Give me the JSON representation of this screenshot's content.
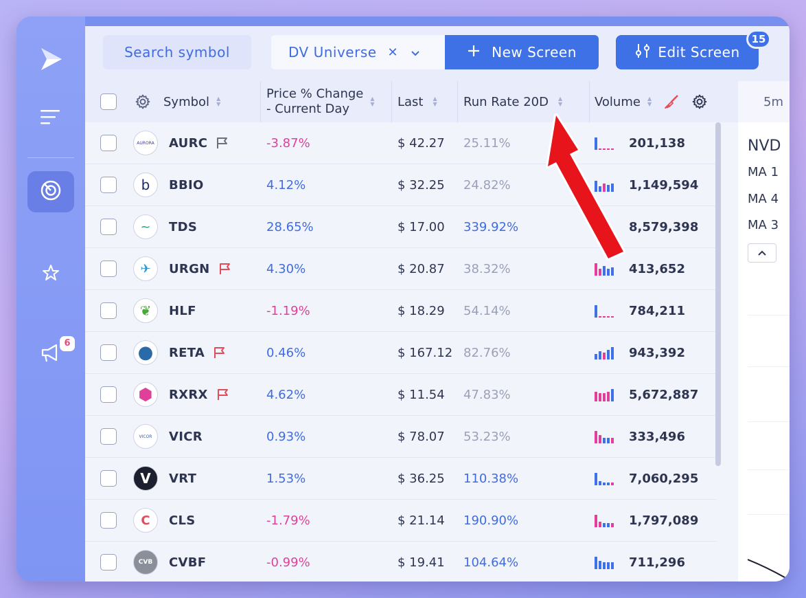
{
  "sidebar": {
    "items": [
      {
        "name": "logo",
        "icon": "play-logo-icon"
      },
      {
        "name": "menu",
        "icon": "menu-lines-icon"
      },
      {
        "name": "scanner",
        "icon": "radar-icon",
        "active": true
      },
      {
        "name": "watchlist",
        "icon": "star-icon"
      },
      {
        "name": "announcements",
        "icon": "megaphone-icon",
        "badge": "6"
      }
    ]
  },
  "toolbar": {
    "search_label": "Search symbol",
    "universe_label": "DV Universe",
    "new_screen_label": "New Screen",
    "edit_screen_label": "Edit Screen",
    "edit_badge": "15"
  },
  "columns": {
    "symbol": "Symbol",
    "price_change_l1": "Price % Change",
    "price_change_l2": "- Current Day",
    "last": "Last",
    "run_rate": "Run Rate 20D",
    "volume": "Volume"
  },
  "right_panel": {
    "timeframe": "5m",
    "ticker": "NVD",
    "ma_lines": [
      "MA 1",
      "MA 4",
      "MA 3"
    ]
  },
  "rows": [
    {
      "symbol": "AURC",
      "flag": "grey",
      "change": "-3.87%",
      "dir": "neg",
      "last": "$ 42.27",
      "run_rate": "25.11%",
      "rr": "muted",
      "volume": "201,138",
      "logo": "AURORA"
    },
    {
      "symbol": "BBIO",
      "flag": "",
      "change": "4.12%",
      "dir": "pos",
      "last": "$ 32.25",
      "run_rate": "24.82%",
      "rr": "muted",
      "volume": "1,149,594",
      "logo": "b"
    },
    {
      "symbol": "TDS",
      "flag": "",
      "change": "28.65%",
      "dir": "pos",
      "last": "$ 17.00",
      "run_rate": "339.92%",
      "rr": "pos",
      "volume": "8,579,398",
      "logo": "~"
    },
    {
      "symbol": "URGN",
      "flag": "red",
      "change": "4.30%",
      "dir": "pos",
      "last": "$ 20.87",
      "run_rate": "38.32%",
      "rr": "muted",
      "volume": "413,652",
      "logo": "✈"
    },
    {
      "symbol": "HLF",
      "flag": "",
      "change": "-1.19%",
      "dir": "neg",
      "last": "$ 18.29",
      "run_rate": "54.14%",
      "rr": "muted",
      "volume": "784,211",
      "logo": "❦"
    },
    {
      "symbol": "RETA",
      "flag": "red",
      "change": "0.46%",
      "dir": "pos",
      "last": "$ 167.12",
      "run_rate": "82.76%",
      "rr": "muted",
      "volume": "943,392",
      "logo": "●"
    },
    {
      "symbol": "RXRX",
      "flag": "red",
      "change": "4.62%",
      "dir": "pos",
      "last": "$ 11.54",
      "run_rate": "47.83%",
      "rr": "muted",
      "volume": "5,672,887",
      "logo": "⬢"
    },
    {
      "symbol": "VICR",
      "flag": "",
      "change": "0.93%",
      "dir": "pos",
      "last": "$ 78.07",
      "run_rate": "53.23%",
      "rr": "muted",
      "volume": "333,496",
      "logo": "VICOR"
    },
    {
      "symbol": "VRT",
      "flag": "",
      "change": "1.53%",
      "dir": "pos",
      "last": "$ 36.25",
      "run_rate": "110.38%",
      "rr": "pos",
      "volume": "7,060,295",
      "logo": "V"
    },
    {
      "symbol": "CLS",
      "flag": "",
      "change": "-1.79%",
      "dir": "neg",
      "last": "$ 21.14",
      "run_rate": "190.90%",
      "rr": "pos",
      "volume": "1,797,089",
      "logo": "C"
    },
    {
      "symbol": "CVBF",
      "flag": "",
      "change": "-0.99%",
      "dir": "neg",
      "last": "$ 19.41",
      "run_rate": "104.64%",
      "rr": "pos",
      "volume": "711,296",
      "logo": "CVB"
    }
  ],
  "colors": {
    "accent": "#3e70e6",
    "negative": "#e0409a",
    "positive": "#3f6ce0",
    "flag_red": "#e24d5a",
    "annotation_arrow": "#e8141c"
  }
}
